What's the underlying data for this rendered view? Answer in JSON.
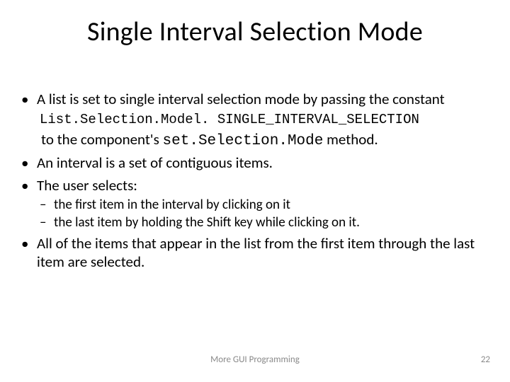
{
  "title": "Single Interval Selection Mode",
  "bullets": {
    "b1_lead": "A list is set to single interval selection mode by passing the constant",
    "b1_code": "List.Selection.Model. SINGLE_INTERVAL_SELECTION",
    "b1_tail_pre": "to the component's ",
    "b1_tail_code": "set.Selection.Mode",
    "b1_tail_post": " method.",
    "b2": "An interval is a set of contiguous items.",
    "b3": "The user selects:",
    "b3_sub1": " the first item in the interval by clicking on it",
    "b3_sub2": "the last item by holding the Shift key while clicking on it.",
    "b4": "All of the items that appear in the list from the first item through the last item are selected."
  },
  "footer": {
    "center": "More GUI Programming",
    "page": "22"
  }
}
